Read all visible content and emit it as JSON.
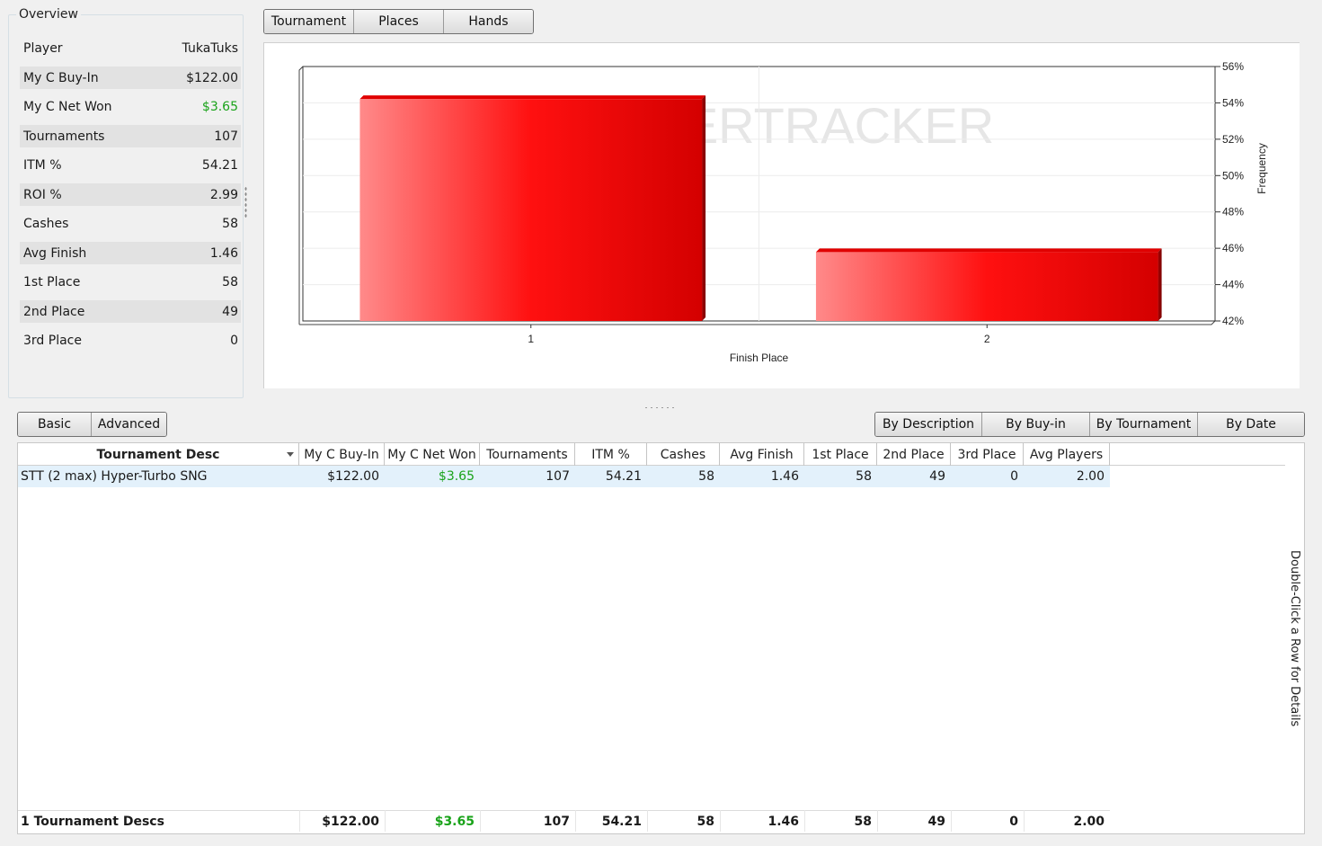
{
  "overview": {
    "title": "Overview",
    "rows": [
      {
        "label": "Player",
        "value": "TukaTuks"
      },
      {
        "label": "My C Buy-In",
        "value": "$122.00"
      },
      {
        "label": "My C Net Won",
        "value": "$3.65"
      },
      {
        "label": "Tournaments",
        "value": "107"
      },
      {
        "label": "ITM %",
        "value": "54.21"
      },
      {
        "label": "ROI %",
        "value": "2.99"
      },
      {
        "label": "Cashes",
        "value": "58"
      },
      {
        "label": "Avg Finish",
        "value": "1.46"
      },
      {
        "label": "1st Place",
        "value": "58"
      },
      {
        "label": "2nd Place",
        "value": "49"
      },
      {
        "label": "3rd Place",
        "value": "0"
      }
    ]
  },
  "top_tabs": [
    "Tournament",
    "Places",
    "Hands"
  ],
  "view_tabs": [
    "Basic",
    "Advanced"
  ],
  "group_tabs": [
    "By Description",
    "By Buy-in",
    "By Tournament",
    "By Date"
  ],
  "chart_data": {
    "type": "bar",
    "categories": [
      "1",
      "2"
    ],
    "values": [
      54.21,
      45.79
    ],
    "xlabel": "Finish Place",
    "ylabel": "Frequency",
    "ylim": [
      42,
      56
    ],
    "yticks": [
      "42%",
      "44%",
      "46%",
      "48%",
      "50%",
      "52%",
      "54%",
      "56%"
    ],
    "watermark": "ERTRACKER",
    "bar_color": "#ff0000"
  },
  "grid": {
    "columns": [
      "Tournament Desc",
      "My C Buy-In",
      "My C Net Won",
      "Tournaments",
      "ITM %",
      "Cashes",
      "Avg Finish",
      "1st Place",
      "2nd Place",
      "3rd Place",
      "Avg Players"
    ],
    "rows": [
      [
        "STT (2 max) Hyper-Turbo SNG",
        "$122.00",
        "$3.65",
        "107",
        "54.21",
        "58",
        "1.46",
        "58",
        "49",
        "0",
        "2.00"
      ]
    ],
    "totals": [
      "1 Tournament Descs",
      "$122.00",
      "$3.65",
      "107",
      "54.21",
      "58",
      "1.46",
      "58",
      "49",
      "0",
      "2.00"
    ],
    "hint": "Double-Click a Row for Details"
  },
  "colors": {
    "positive": "#1aa31a",
    "selected_row": "#e3f1fb"
  }
}
